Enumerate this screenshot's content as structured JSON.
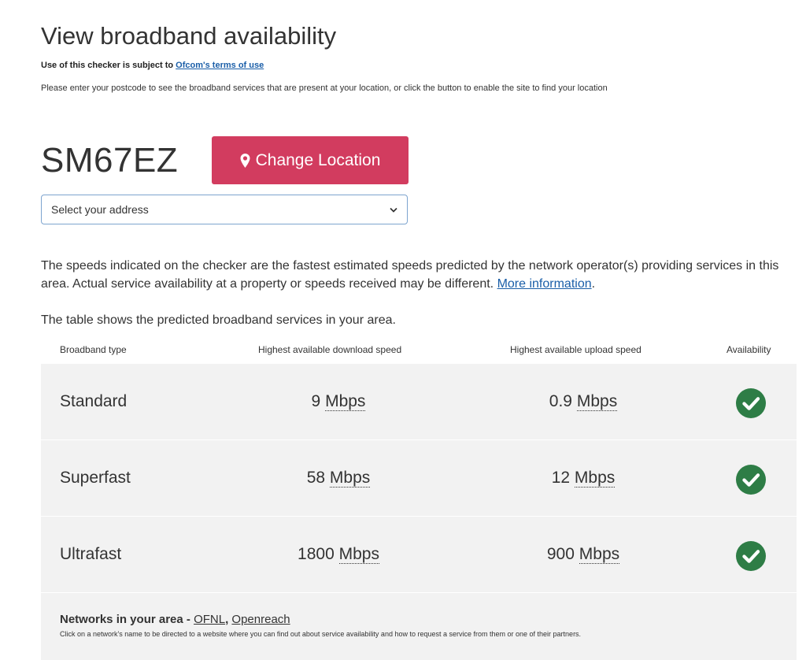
{
  "header": {
    "title": "View broadband availability",
    "terms_prefix": "Use of this checker is subject to ",
    "terms_link": "Ofcom's terms of use",
    "instructions": "Please enter your postcode to see the broadband services that are present at your location, or click the button to enable the site to find your location"
  },
  "location": {
    "postcode": "SM67EZ",
    "change_label": "Change Location",
    "address_select": "Select your address"
  },
  "info": {
    "speeds_text": "The speeds indicated on the checker are the fastest estimated speeds predicted by the network operator(s) providing services in this area. Actual service availability at a property or speeds received may be different. ",
    "more_info_link": "More information",
    "after_link": ".",
    "table_intro": "The table shows the predicted broadband services in your area."
  },
  "table": {
    "headers": {
      "type": "Broadband type",
      "download": "Highest available download speed",
      "upload": "Highest available upload speed",
      "availability": "Availability"
    },
    "rows": [
      {
        "type": "Standard",
        "download": "9",
        "upload": "0.9",
        "unit": "Mbps"
      },
      {
        "type": "Superfast",
        "download": "58",
        "upload": "12",
        "unit": "Mbps"
      },
      {
        "type": "Ultrafast",
        "download": "1800",
        "upload": "900",
        "unit": "Mbps"
      }
    ],
    "check_color": "#2e7d46"
  },
  "networks": {
    "label": "Networks in your area - ",
    "items": [
      "OFNL",
      "Openreach"
    ],
    "separator": ", ",
    "description": "Click on a network's name to be directed to a website where you can find out about service availability and how to request a service from them or one of their partners."
  },
  "colors": {
    "accent": "#d23c5f",
    "link": "#1a5ea8"
  },
  "icons": {
    "location": "map-marker-icon",
    "select": "chevron-down-icon",
    "availability": "check-circle-icon"
  }
}
